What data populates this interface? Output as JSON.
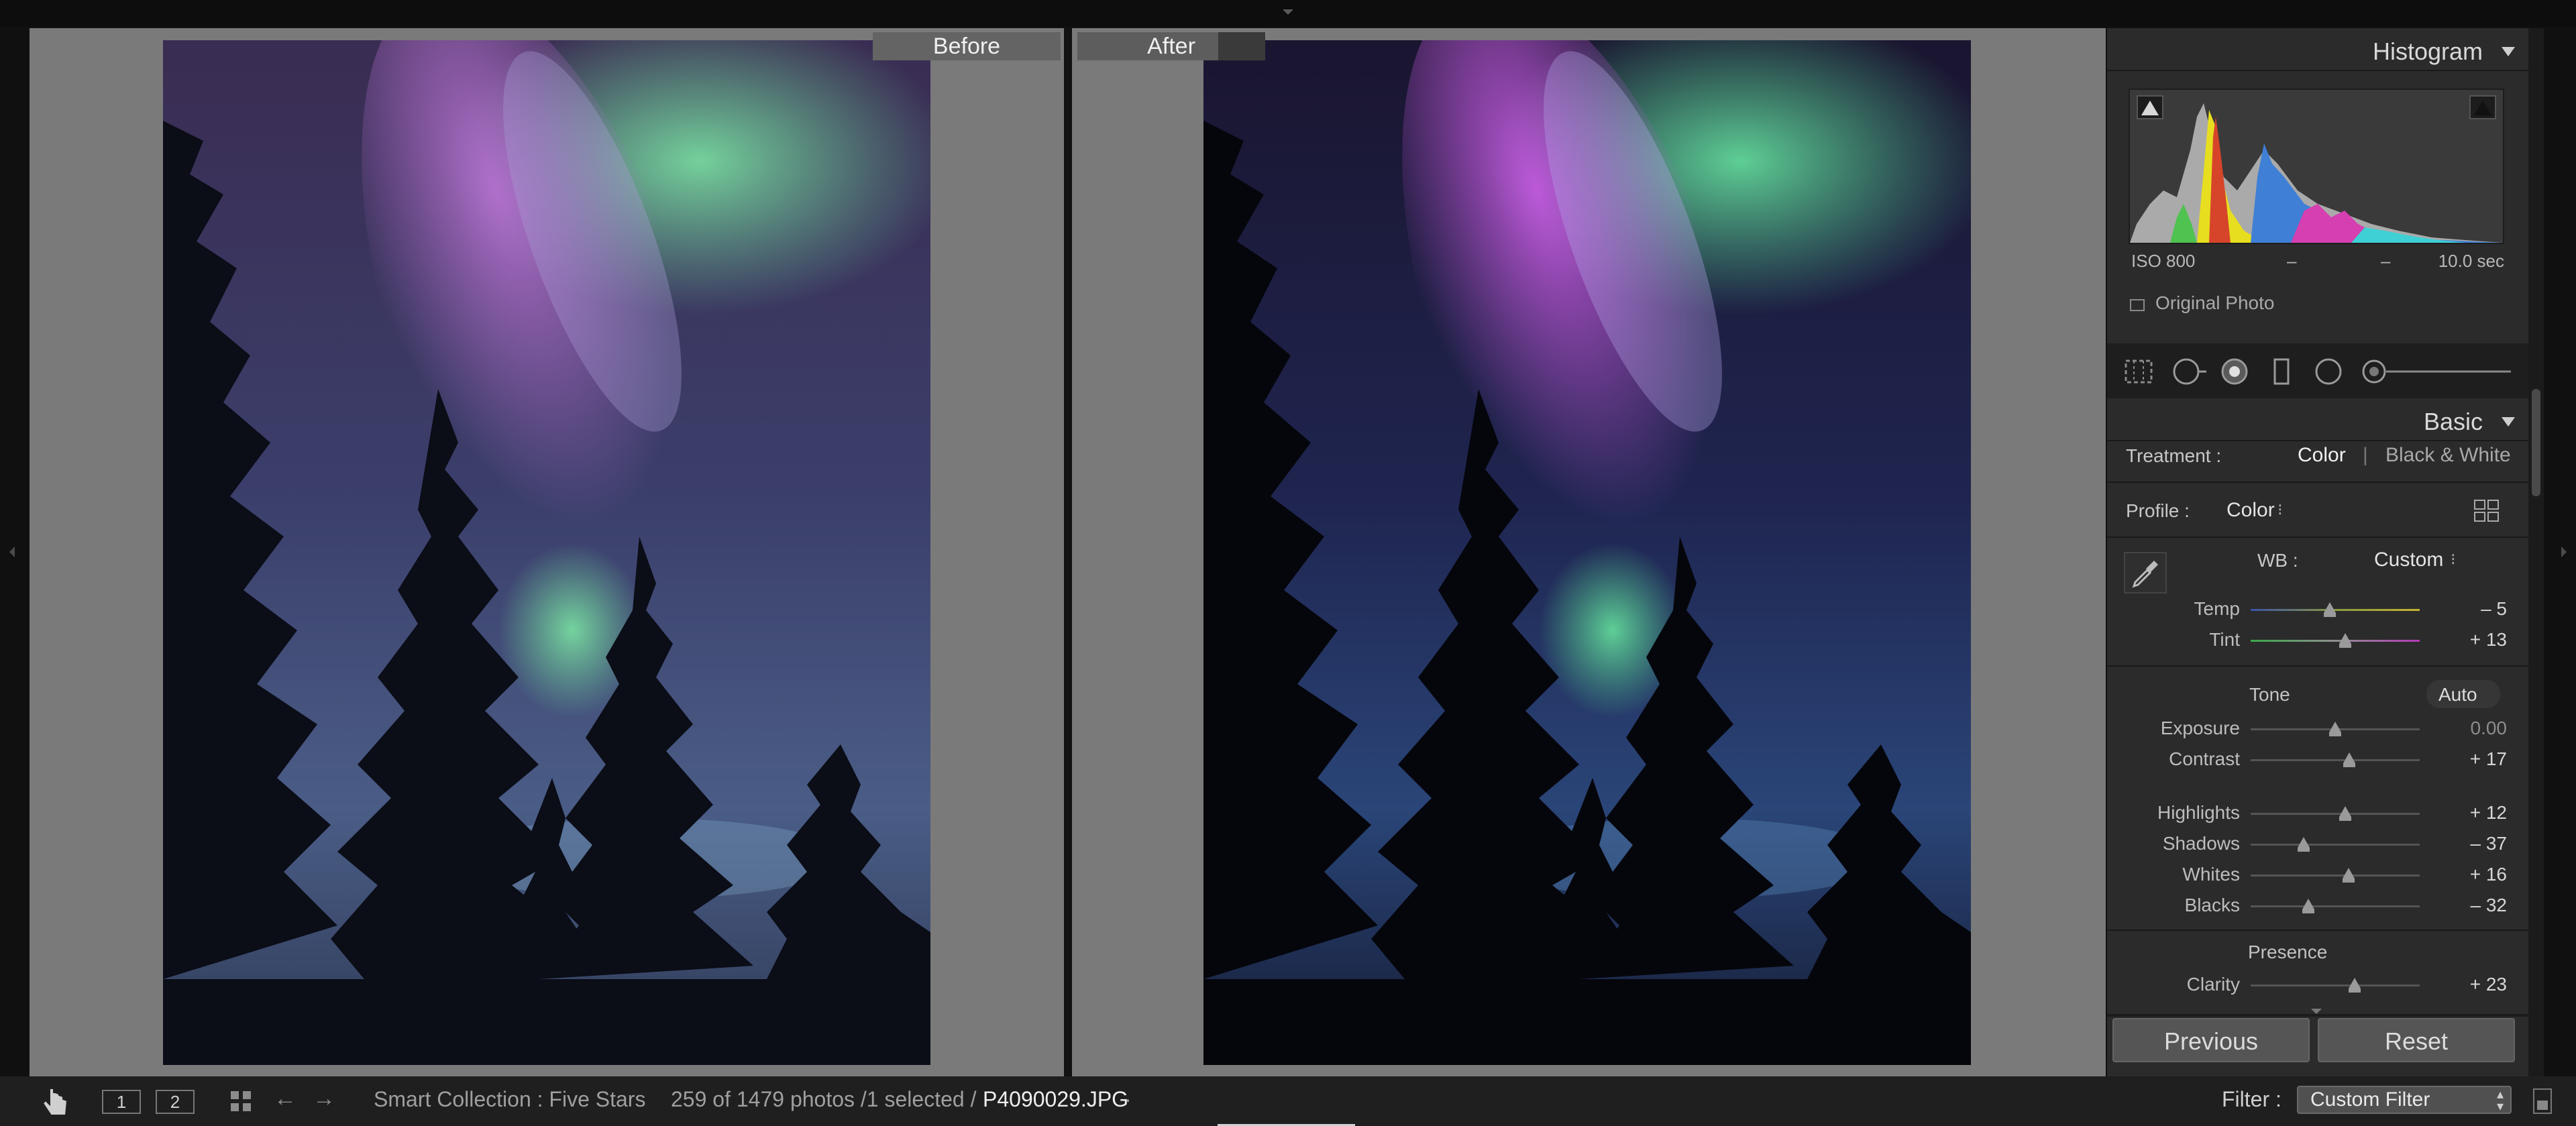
{
  "compare": {
    "before_label": "Before",
    "after_label": "After"
  },
  "histogram": {
    "title": "Histogram",
    "iso": "ISO 800",
    "focal": "–",
    "aperture": "–",
    "shutter": "10.0 sec",
    "original_photo_label": "Original Photo"
  },
  "basic": {
    "title": "Basic",
    "treatment_label": "Treatment :",
    "treatment_color": "Color",
    "treatment_bw": "Black & White",
    "profile_label": "Profile :",
    "profile_value": "Color",
    "wb_label": "WB :",
    "wb_value": "Custom",
    "temp": {
      "label": "Temp",
      "value": "– 5",
      "level": 0.47
    },
    "tint": {
      "label": "Tint",
      "value": "+ 13",
      "level": 0.56
    },
    "tone_label": "Tone",
    "auto_label": "Auto",
    "exposure": {
      "label": "Exposure",
      "value": "0.00",
      "level": 0.5
    },
    "contrast": {
      "label": "Contrast",
      "value": "+ 17",
      "level": 0.585
    },
    "highlights": {
      "label": "Highlights",
      "value": "+ 12",
      "level": 0.56
    },
    "shadows": {
      "label": "Shadows",
      "value": "– 37",
      "level": 0.315
    },
    "whites": {
      "label": "Whites",
      "value": "+ 16",
      "level": 0.58
    },
    "blacks": {
      "label": "Blacks",
      "value": "– 32",
      "level": 0.34
    },
    "presence_label": "Presence",
    "clarity": {
      "label": "Clarity",
      "value": "+ 23",
      "level": 0.615
    }
  },
  "buttons": {
    "previous": "Previous",
    "reset": "Reset"
  },
  "filmstrip": {
    "view1": "1",
    "view2": "2",
    "source": "Smart Collection : Five Stars",
    "count": "259 of 1479 photos /1 selected /",
    "filename": "P4090029.JPG",
    "filename_arrow": "·",
    "filter_label": "Filter :",
    "filter_value": "Custom Filter"
  }
}
